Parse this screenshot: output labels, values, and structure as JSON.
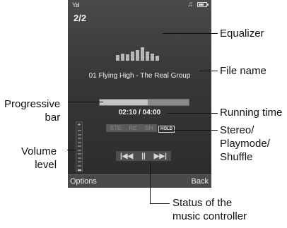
{
  "screen": {
    "status_bar": {
      "signal_icon": "signal-icon",
      "music_icon": "music-note-icon",
      "battery_icon": "battery-icon",
      "battery_level": 0.7
    },
    "track_counter": "2/2",
    "equalizer": {
      "levels": [
        0.35,
        0.45,
        0.4,
        0.6,
        0.7,
        0.85,
        0.6,
        0.45,
        0.3
      ]
    },
    "file_name": "01 Flying High - The Real Group",
    "progress": {
      "value": 0.54
    },
    "running_time": "02:10 / 04:00",
    "modes": [
      "STE",
      "RE",
      "SH"
    ],
    "hold_badge": "HOLD",
    "volume": {
      "plus_symbol": "+",
      "steps": 10
    },
    "controls": {
      "prev": "|◀◀",
      "pause": "||",
      "next": "▶▶|"
    },
    "softkeys": {
      "left": "Options",
      "right": "Back"
    }
  },
  "annotations": {
    "equalizer": "Equalizer",
    "file_name": "File name",
    "progressive_bar": [
      "Progressive",
      "bar"
    ],
    "running_time": "Running time",
    "stereo": [
      "Stereo/",
      "Playmode/",
      "Shuffle"
    ],
    "volume_level": [
      "Volume",
      "level"
    ],
    "status": [
      "Status of the",
      "music controller"
    ]
  }
}
